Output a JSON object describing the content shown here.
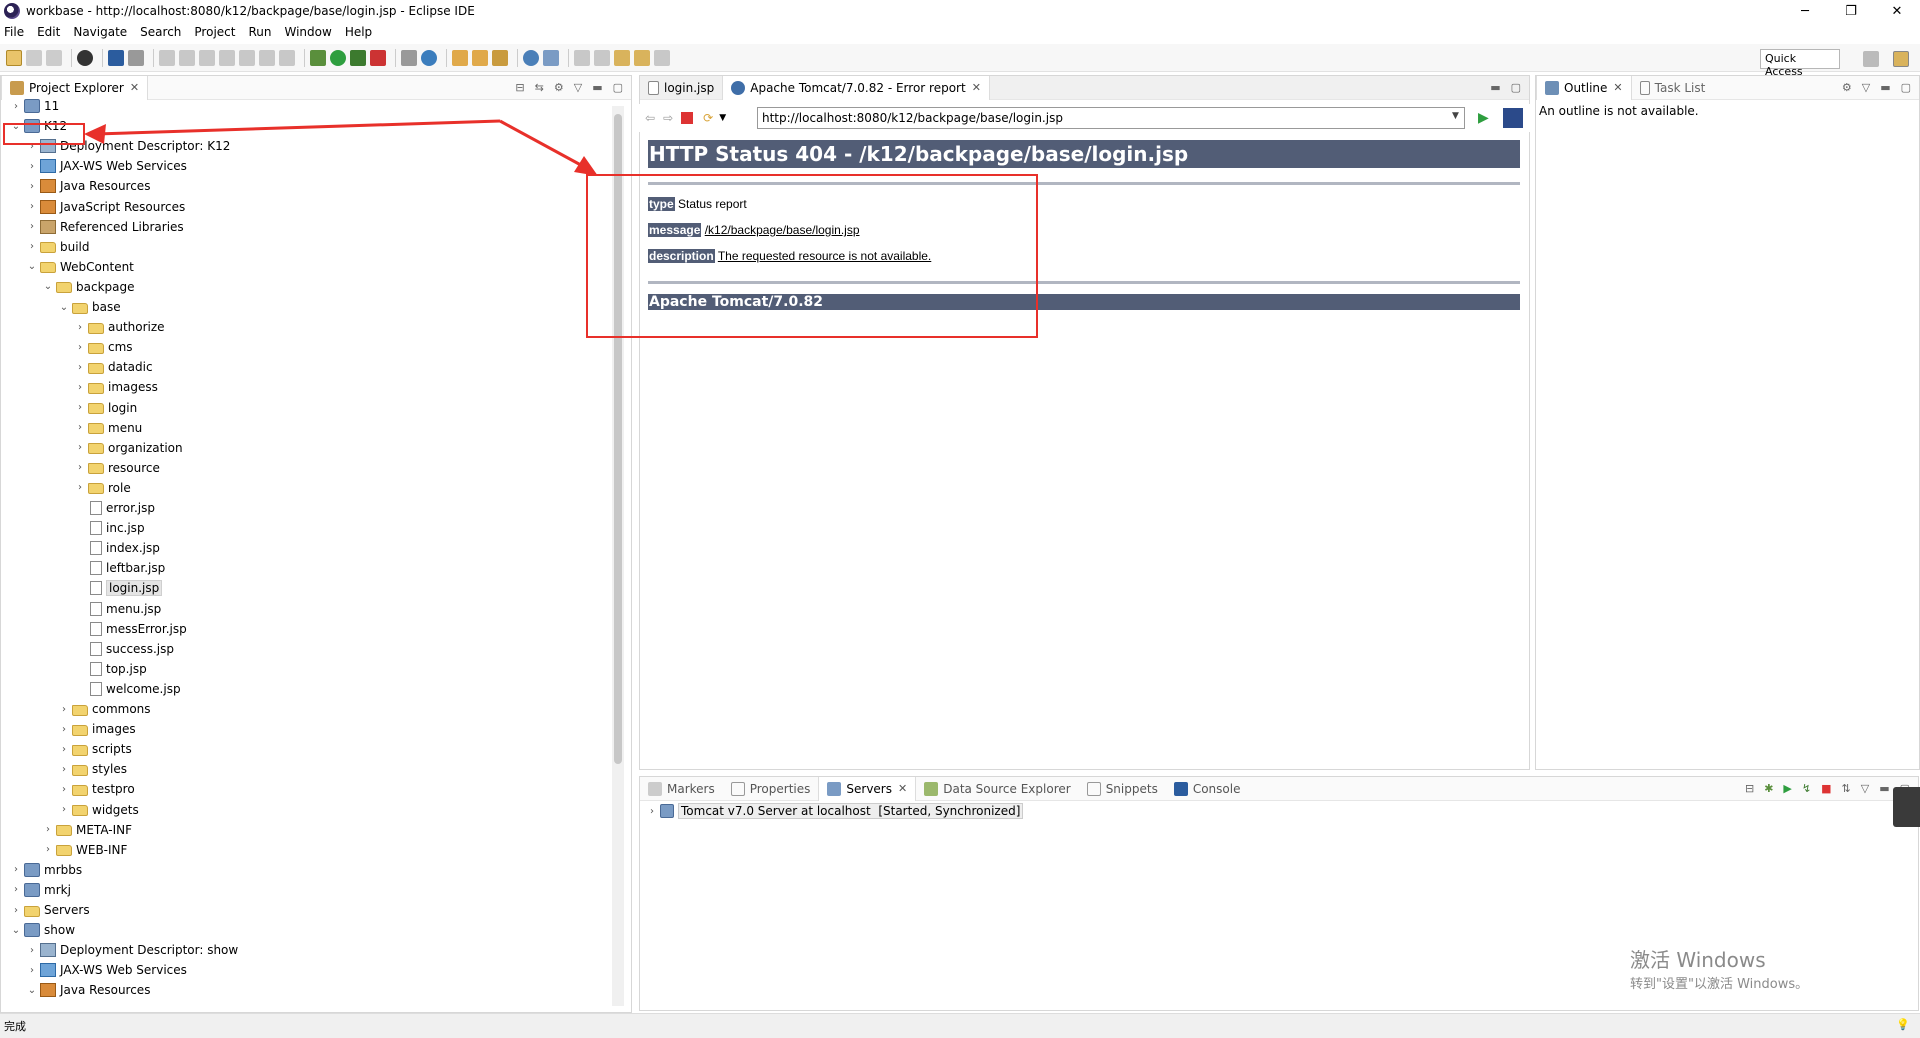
{
  "window": {
    "title": "workbase - http://localhost:8080/k12/backpage/base/login.jsp - Eclipse IDE",
    "controls": [
      "─",
      "❐",
      "✕"
    ]
  },
  "menubar": [
    "File",
    "Edit",
    "Navigate",
    "Search",
    "Project",
    "Run",
    "Window",
    "Help"
  ],
  "toolbar": {
    "quick_access": "Quick Access"
  },
  "project_explorer": {
    "tab_label": "Project Explorer",
    "tree": [
      {
        "label": "11",
        "depth": 0,
        "type": "proj",
        "expanded": false
      },
      {
        "label": "K12",
        "depth": 0,
        "type": "proj",
        "expanded": true
      },
      {
        "label": "Deployment Descriptor: K12",
        "depth": 1,
        "type": "dd",
        "expanded": false
      },
      {
        "label": "JAX-WS Web Services",
        "depth": 1,
        "type": "webs",
        "expanded": false
      },
      {
        "label": "Java Resources",
        "depth": 1,
        "type": "jres",
        "expanded": false
      },
      {
        "label": "JavaScript Resources",
        "depth": 1,
        "type": "jres",
        "expanded": false
      },
      {
        "label": "Referenced Libraries",
        "depth": 1,
        "type": "lib",
        "expanded": false
      },
      {
        "label": "build",
        "depth": 1,
        "type": "folder",
        "expanded": false
      },
      {
        "label": "WebContent",
        "depth": 1,
        "type": "folder",
        "expanded": true
      },
      {
        "label": "backpage",
        "depth": 2,
        "type": "folder",
        "expanded": true
      },
      {
        "label": "base",
        "depth": 3,
        "type": "folder",
        "expanded": true
      },
      {
        "label": "authorize",
        "depth": 4,
        "type": "folder",
        "expanded": false
      },
      {
        "label": "cms",
        "depth": 4,
        "type": "folder",
        "expanded": false
      },
      {
        "label": "datadic",
        "depth": 4,
        "type": "folder",
        "expanded": false
      },
      {
        "label": "imagess",
        "depth": 4,
        "type": "folder",
        "expanded": false
      },
      {
        "label": "login",
        "depth": 4,
        "type": "folder",
        "expanded": false
      },
      {
        "label": "menu",
        "depth": 4,
        "type": "folder",
        "expanded": false
      },
      {
        "label": "organization",
        "depth": 4,
        "type": "folder",
        "expanded": false
      },
      {
        "label": "resource",
        "depth": 4,
        "type": "folder",
        "expanded": false
      },
      {
        "label": "role",
        "depth": 4,
        "type": "folder",
        "expanded": false
      },
      {
        "label": "error.jsp",
        "depth": 4,
        "type": "file"
      },
      {
        "label": "inc.jsp",
        "depth": 4,
        "type": "file"
      },
      {
        "label": "index.jsp",
        "depth": 4,
        "type": "file"
      },
      {
        "label": "leftbar.jsp",
        "depth": 4,
        "type": "file"
      },
      {
        "label": "login.jsp",
        "depth": 4,
        "type": "file",
        "selected": true
      },
      {
        "label": "menu.jsp",
        "depth": 4,
        "type": "file"
      },
      {
        "label": "messError.jsp",
        "depth": 4,
        "type": "file"
      },
      {
        "label": "success.jsp",
        "depth": 4,
        "type": "file"
      },
      {
        "label": "top.jsp",
        "depth": 4,
        "type": "file"
      },
      {
        "label": "welcome.jsp",
        "depth": 4,
        "type": "file"
      },
      {
        "label": "commons",
        "depth": 3,
        "type": "folder",
        "expanded": false
      },
      {
        "label": "images",
        "depth": 3,
        "type": "folder",
        "expanded": false
      },
      {
        "label": "scripts",
        "depth": 3,
        "type": "folder",
        "expanded": false
      },
      {
        "label": "styles",
        "depth": 3,
        "type": "folder",
        "expanded": false
      },
      {
        "label": "testpro",
        "depth": 3,
        "type": "folder",
        "expanded": false
      },
      {
        "label": "widgets",
        "depth": 3,
        "type": "folder",
        "expanded": false
      },
      {
        "label": "META-INF",
        "depth": 2,
        "type": "folder",
        "expanded": false
      },
      {
        "label": "WEB-INF",
        "depth": 2,
        "type": "folder",
        "expanded": false
      },
      {
        "label": "mrbbs",
        "depth": 0,
        "type": "proj",
        "expanded": false
      },
      {
        "label": "mrkj",
        "depth": 0,
        "type": "proj",
        "expanded": false
      },
      {
        "label": "Servers",
        "depth": 0,
        "type": "folder",
        "expanded": false
      },
      {
        "label": "show",
        "depth": 0,
        "type": "proj",
        "expanded": true
      },
      {
        "label": "Deployment Descriptor: show",
        "depth": 1,
        "type": "dd",
        "expanded": false
      },
      {
        "label": "JAX-WS Web Services",
        "depth": 1,
        "type": "webs",
        "expanded": false
      },
      {
        "label": "Java Resources",
        "depth": 1,
        "type": "jres",
        "expanded": true
      }
    ]
  },
  "editor": {
    "tabs": [
      {
        "label": "login.jsp",
        "active": false
      },
      {
        "label": "Apache Tomcat/7.0.82 - Error report",
        "active": true
      }
    ],
    "url": "http://localhost:8080/k12/backpage/base/login.jsp",
    "page": {
      "heading": "HTTP Status 404 - /k12/backpage/base/login.jsp",
      "type_label": "type",
      "type_value": "Status report",
      "message_label": "message",
      "message_value": "/k12/backpage/base/login.jsp",
      "description_label": "description",
      "description_value": "The requested resource is not available.",
      "footer": "Apache Tomcat/7.0.82"
    }
  },
  "outline": {
    "tabs": [
      "Outline",
      "Task List"
    ],
    "message": "An outline is not available."
  },
  "bottom": {
    "tabs": [
      "Markers",
      "Properties",
      "Servers",
      "Data Source Explorer",
      "Snippets",
      "Console"
    ],
    "active_tab": "Servers",
    "server_entry": "Tomcat v7.0 Server at localhost  [Started, Synchronized]"
  },
  "status": {
    "text": "完成"
  },
  "watermark": {
    "line1": "激活 Windows",
    "line2": "转到\"设置\"以激活 Windows。"
  },
  "colors": {
    "tomcat_header": "#525d76",
    "annotation_red": "#e8302a"
  }
}
